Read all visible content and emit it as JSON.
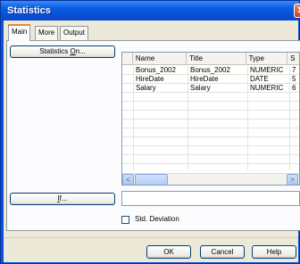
{
  "window": {
    "title": "Statistics",
    "close_glyph": "✕"
  },
  "tabs": [
    {
      "label": "Main",
      "active": true
    },
    {
      "label": "More",
      "active": false
    },
    {
      "label": "Output",
      "active": false
    }
  ],
  "main": {
    "statistics_on_label_pre": "Statistics ",
    "statistics_on_label_u": "O",
    "statistics_on_label_post": "n...",
    "if_label_u": "I",
    "if_label_post": "f...",
    "if_value": "",
    "std_dev_label": "Std. Deviation",
    "std_dev_checked": false
  },
  "grid": {
    "columns": [
      "",
      "Name",
      "Title",
      "Type",
      "S"
    ],
    "rows": [
      [
        "",
        "Bonus_2002",
        "Bonus_2002",
        "NUMERIC",
        "7"
      ],
      [
        "",
        "HireDate",
        "HireDate",
        "DATE",
        "5"
      ],
      [
        "",
        "Salary",
        "Salary",
        "NUMERIC",
        "6"
      ]
    ],
    "scroll_left_glyph": "<",
    "scroll_right_glyph": ">"
  },
  "footer": {
    "ok_label": "OK",
    "cancel_label": "Cancel",
    "help_label": "Help"
  },
  "colors": {
    "titlebar": "#0a5ee3",
    "dialog_bg": "#ece9d8",
    "panel_bg": "#fcfcfe",
    "active_tab_accent": "#e68b2c"
  }
}
